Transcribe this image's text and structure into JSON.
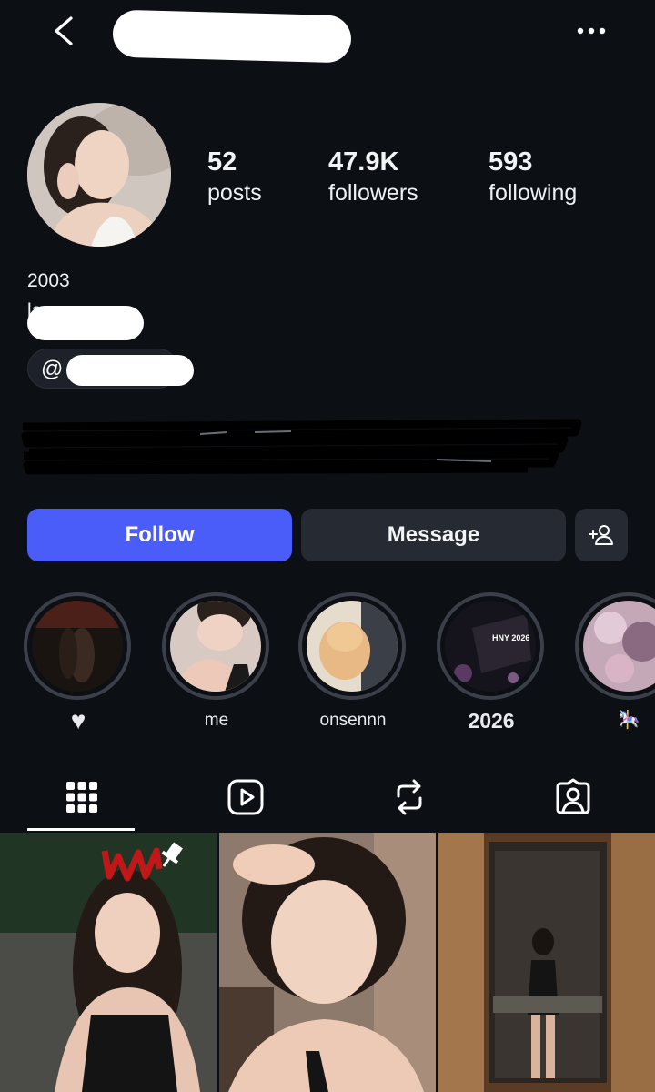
{
  "header": {
    "username_redacted": true
  },
  "stats": {
    "posts_value": "52",
    "posts_label": "posts",
    "followers_value": "47.9K",
    "followers_label": "followers",
    "following_value": "593",
    "following_label": "following"
  },
  "bio": {
    "line1": "2003",
    "line2": "law me"
  },
  "threads_badge": {
    "icon": "threads-icon"
  },
  "actions": {
    "follow_label": "Follow",
    "message_label": "Message"
  },
  "highlights": [
    {
      "label": "♥",
      "style": "icon"
    },
    {
      "label": "me",
      "style": "normal"
    },
    {
      "label": "onsennn",
      "style": "normal"
    },
    {
      "label": "2026",
      "style": "big",
      "cover_text": "HNY 2026"
    },
    {
      "label": "🎠",
      "style": "normal"
    }
  ],
  "tabs": [
    {
      "name": "posts",
      "icon": "grid-icon",
      "active": true
    },
    {
      "name": "reels",
      "icon": "reels-icon",
      "active": false
    },
    {
      "name": "reposts",
      "icon": "repost-icon",
      "active": false
    },
    {
      "name": "tagged",
      "icon": "tagged-icon",
      "active": false
    }
  ],
  "colors": {
    "background": "#0c0f14",
    "follow_button": "#4a5df9",
    "secondary_button": "#262a33"
  }
}
